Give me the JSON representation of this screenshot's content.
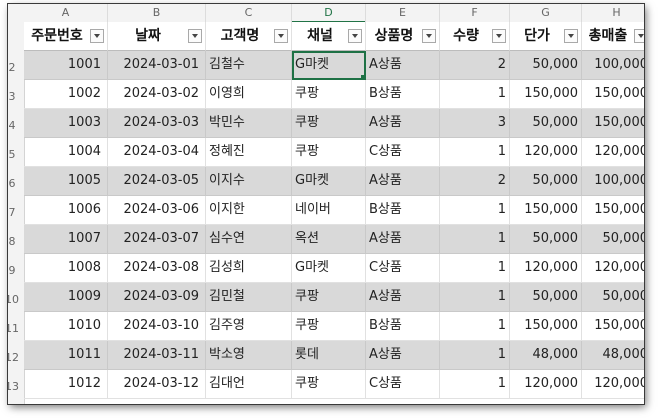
{
  "column_letters": [
    "A",
    "B",
    "C",
    "D",
    "E",
    "F",
    "G",
    "H"
  ],
  "row_numbers": [
    "2",
    "3",
    "4",
    "5",
    "6",
    "7",
    "8",
    "9",
    "10",
    "11",
    "12",
    "13"
  ],
  "headers": [
    "주문번호",
    "날짜",
    "고객명",
    "채널",
    "상품명",
    "수량",
    "단가",
    "총매출"
  ],
  "rows": [
    [
      "1001",
      "2024-03-01",
      "김철수",
      "G마켓",
      "A상품",
      "2",
      "50,000",
      "100,000"
    ],
    [
      "1002",
      "2024-03-02",
      "이영희",
      "쿠팡",
      "B상품",
      "1",
      "150,000",
      "150,000"
    ],
    [
      "1003",
      "2024-03-03",
      "박민수",
      "쿠팡",
      "A상품",
      "3",
      "50,000",
      "150,000"
    ],
    [
      "1004",
      "2024-03-04",
      "정혜진",
      "쿠팡",
      "C상품",
      "1",
      "120,000",
      "120,000"
    ],
    [
      "1005",
      "2024-03-05",
      "이지수",
      "G마켓",
      "A상품",
      "2",
      "50,000",
      "100,000"
    ],
    [
      "1006",
      "2024-03-06",
      "이지한",
      "네이버",
      "B상품",
      "1",
      "150,000",
      "150,000"
    ],
    [
      "1007",
      "2024-03-07",
      "심수연",
      "옥션",
      "A상품",
      "1",
      "50,000",
      "50,000"
    ],
    [
      "1008",
      "2024-03-08",
      "김성희",
      "G마켓",
      "C상품",
      "1",
      "120,000",
      "120,000"
    ],
    [
      "1009",
      "2024-03-09",
      "김민철",
      "쿠팡",
      "A상품",
      "1",
      "50,000",
      "50,000"
    ],
    [
      "1010",
      "2024-03-10",
      "김주영",
      "쿠팡",
      "B상품",
      "1",
      "150,000",
      "150,000"
    ],
    [
      "1011",
      "2024-03-11",
      "박소영",
      "롯데",
      "A상품",
      "1",
      "48,000",
      "48,000"
    ],
    [
      "1012",
      "2024-03-12",
      "김대언",
      "쿠팡",
      "C상품",
      "1",
      "120,000",
      "120,000"
    ]
  ],
  "selected_cell": "D2",
  "colors": {
    "band": "#d9d9d9",
    "selection": "#1e7145"
  }
}
